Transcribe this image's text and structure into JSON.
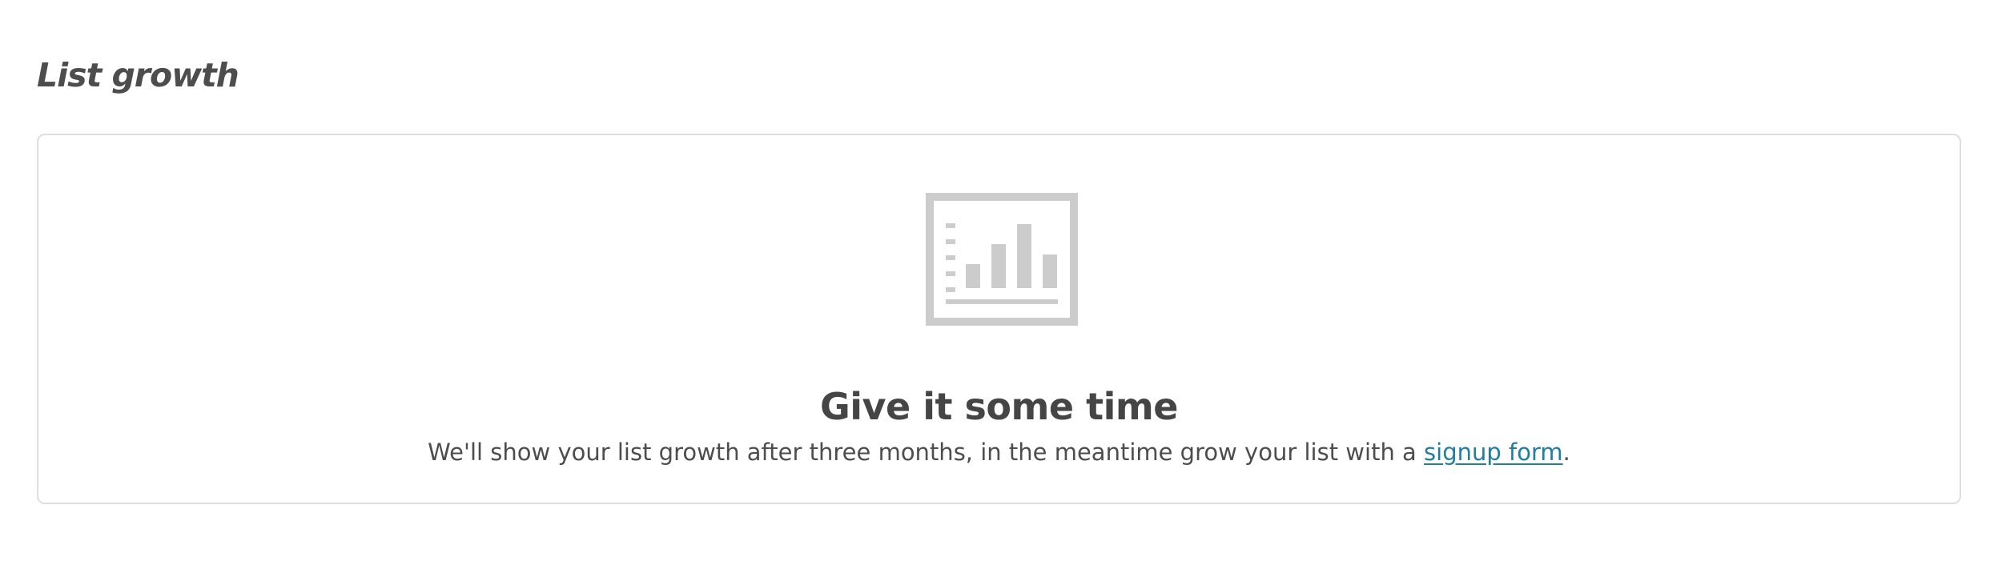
{
  "section": {
    "title": "List growth"
  },
  "empty_state": {
    "icon": "bar-chart-icon",
    "heading": "Give it some time",
    "message_before_link": "We'll show your list growth after three months, in the meantime grow your list with a ",
    "link_label": "signup form",
    "message_after_link": "."
  },
  "colors": {
    "icon_gray": "#cccccc",
    "link": "#1e7fa0",
    "text": "#454545",
    "border": "#dedede"
  }
}
